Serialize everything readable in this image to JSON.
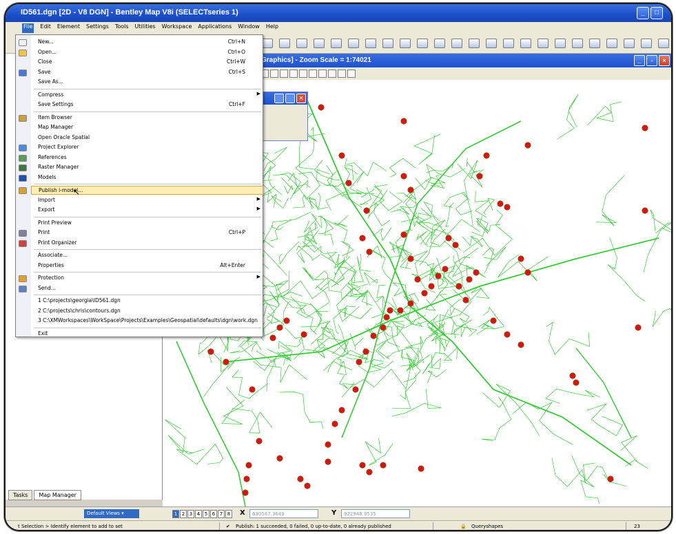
{
  "window": {
    "title": "ID561.dgn [2D - V8 DGN] - Bentley Map V8i (SELECTseries 1)"
  },
  "menubar": [
    "File",
    "Edit",
    "Element",
    "Settings",
    "Tools",
    "Utilities",
    "Workspace",
    "Applications",
    "Window",
    "Help"
  ],
  "view": {
    "title": "Graphics] - Zoom Scale = 1:74021"
  },
  "file_menu": {
    "items": [
      {
        "label": "New...",
        "shortcut": "Ctrl+N"
      },
      {
        "label": "Open...",
        "shortcut": "Ctrl+O"
      },
      {
        "label": "Close",
        "shortcut": "Ctrl+W"
      },
      {
        "label": "Save",
        "shortcut": "Ctrl+S"
      },
      {
        "label": "Save As...",
        "shortcut": ""
      },
      {
        "label": "Compress",
        "shortcut": ""
      },
      {
        "label": "Save Settings",
        "shortcut": "Ctrl+F"
      },
      {
        "label": "Item Browser",
        "shortcut": ""
      },
      {
        "label": "Map Manager",
        "shortcut": ""
      },
      {
        "label": "Open Oracle Spatial",
        "shortcut": ""
      },
      {
        "label": "Project Explorer",
        "shortcut": ""
      },
      {
        "label": "References",
        "shortcut": ""
      },
      {
        "label": "Raster Manager",
        "shortcut": ""
      },
      {
        "label": "Models",
        "shortcut": ""
      },
      {
        "label": "Publish i-model...",
        "shortcut": ""
      },
      {
        "label": "Import",
        "shortcut": ""
      },
      {
        "label": "Export",
        "shortcut": ""
      },
      {
        "label": "Print Preview",
        "shortcut": ""
      },
      {
        "label": "Print",
        "shortcut": "Ctrl+P"
      },
      {
        "label": "Print Organizer",
        "shortcut": ""
      },
      {
        "label": "Associate...",
        "shortcut": ""
      },
      {
        "label": "Properties",
        "shortcut": "Alt+Enter"
      },
      {
        "label": "Protection",
        "shortcut": ""
      },
      {
        "label": "Send...",
        "shortcut": ""
      },
      {
        "label": "1 C:\\projects\\georgia\\ID561.dgn",
        "shortcut": ""
      },
      {
        "label": "2 C:\\projects\\chris\\contours.dgn",
        "shortcut": ""
      },
      {
        "label": "3 C:\\XMWorkspaces\\WorkSpace\\Projects\\Examples\\Geospatial\\defaults\\dgn\\work.dgn",
        "shortcut": ""
      },
      {
        "label": "Exit",
        "shortcut": ""
      }
    ]
  },
  "left_tabs": [
    "Tasks",
    "Map Manager"
  ],
  "viewbar": {
    "default_views": "Default Views",
    "view_numbers": [
      "1",
      "2",
      "3",
      "4",
      "5",
      "6",
      "7",
      "8"
    ],
    "x_label": "X",
    "x_value": "630567.3649",
    "y_label": "Y",
    "y_value": "922948.9535"
  },
  "statusbar": {
    "left": "t Selection > Identify element to add to set",
    "publish": "Publish: 1 succeeded, 0 failed, 0 up-to-date, 0 already published",
    "level": "Queryshapes",
    "count": "23"
  },
  "colors": {
    "road": "#33cc33",
    "point_fill": "#e01010",
    "point_ring": "#7a5b1e",
    "title_blue": "#1b4fc9",
    "menu_highlight": "#fdeeb4"
  }
}
